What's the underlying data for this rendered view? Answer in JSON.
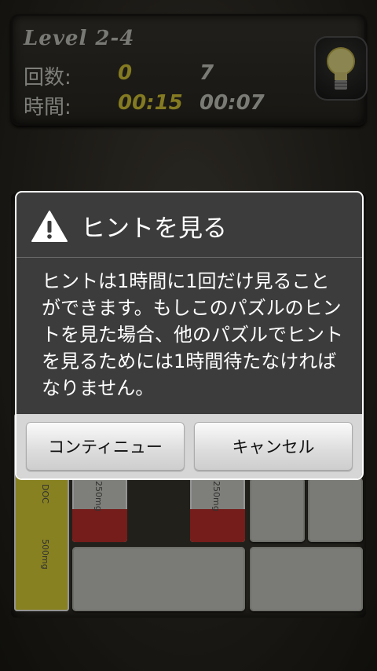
{
  "hud": {
    "level": "Level 2-4",
    "moves_label": "回数:",
    "moves_current": "0",
    "moves_best": "7",
    "time_label": "時間:",
    "time_current": "00:15",
    "time_best": "00:07",
    "hint_icon": "lightbulb-icon"
  },
  "board": {
    "pill_dose_1": "250mg",
    "pill_dose_2": "250mg",
    "pill_dose_3": "500mg",
    "pill_brand": "DOC",
    "colors": {
      "yellow_pill": "#e8df3c",
      "red_pill": "#c8322e",
      "block": "#d2d2cc"
    }
  },
  "dialog": {
    "title": "ヒントを見る",
    "icon": "warning-icon",
    "message": "ヒントは1時間に1回だけ見ることができます。もしこのパズルのヒントを見た場合、他のパズルでヒントを見るためには1時間待たなければなりません。",
    "continue_label": "コンティニュー",
    "cancel_label": "キャンセル"
  }
}
